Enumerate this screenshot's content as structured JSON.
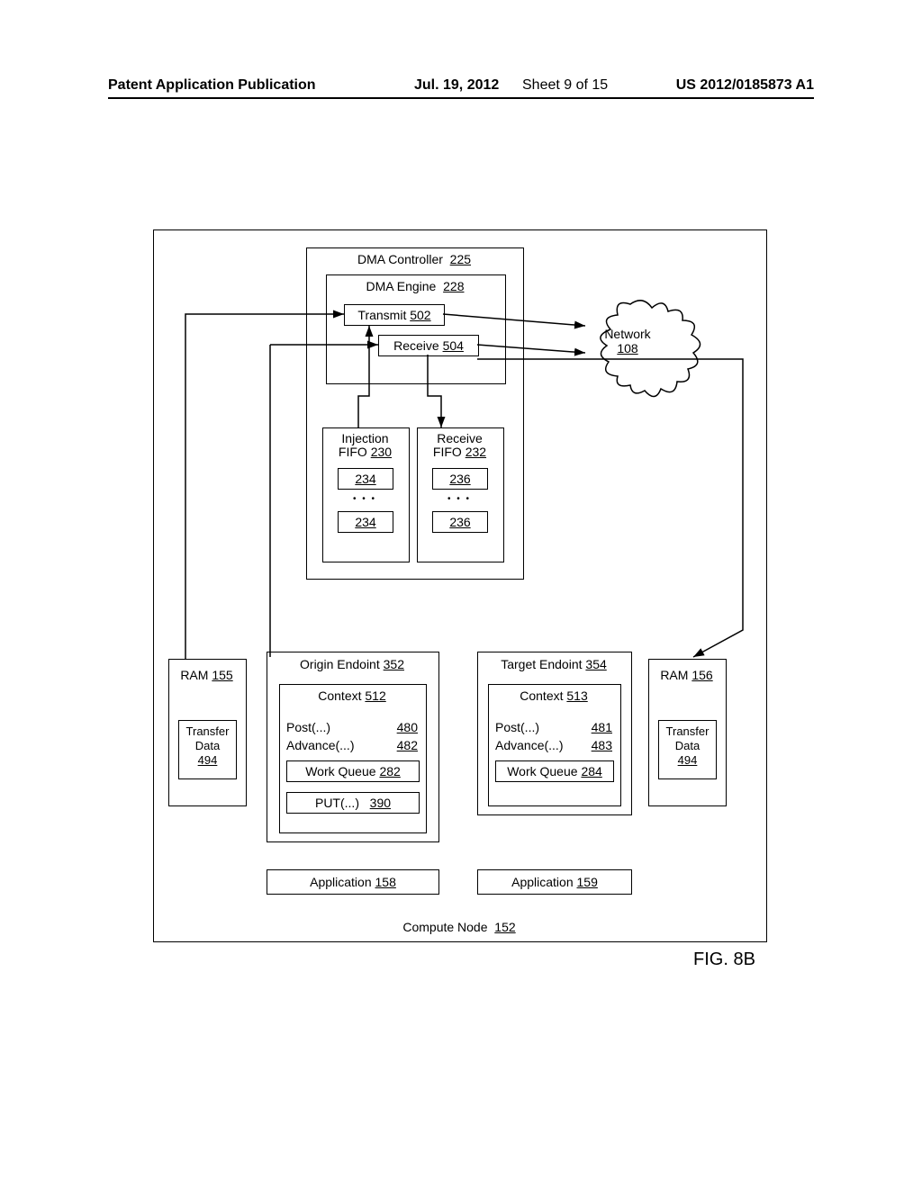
{
  "header": {
    "left": "Patent Application Publication",
    "date": "Jul. 19, 2012",
    "sheet": "Sheet 9 of 15",
    "pubno": "US 2012/0185873 A1"
  },
  "dma_controller": {
    "label": "DMA Controller",
    "ref": "225"
  },
  "dma_engine": {
    "label": "DMA Engine",
    "ref": "228"
  },
  "transmit": {
    "label": "Transmit",
    "ref": "502"
  },
  "receive": {
    "label": "Receive",
    "ref": "504"
  },
  "network": {
    "label": "Network",
    "ref": "108"
  },
  "injection_fifo": {
    "label1": "Injection",
    "label2": "FIFO",
    "ref": "230"
  },
  "receive_fifo": {
    "label1": "Receive",
    "label2": "FIFO",
    "ref": "232"
  },
  "inj_item": {
    "ref": "234"
  },
  "rec_item": {
    "ref": "236"
  },
  "ram_left": {
    "label": "RAM",
    "ref": "155"
  },
  "ram_right": {
    "label": "RAM",
    "ref": "156"
  },
  "transfer_data": {
    "label1": "Transfer",
    "label2": "Data",
    "ref": "494"
  },
  "origin_ep": {
    "label": "Origin Endoint",
    "ref": "352"
  },
  "target_ep": {
    "label": "Target Endoint",
    "ref": "354"
  },
  "context_left": {
    "label": "Context",
    "ref": "512"
  },
  "context_right": {
    "label": "Context",
    "ref": "513"
  },
  "post_left": {
    "label": "Post(...)",
    "ref": "480"
  },
  "post_right": {
    "label": "Post(...)",
    "ref": "481"
  },
  "advance_left": {
    "label": "Advance(...)",
    "ref": "482"
  },
  "advance_right": {
    "label": "Advance(...)",
    "ref": "483"
  },
  "work_queue_left": {
    "label": "Work Queue",
    "ref": "282"
  },
  "work_queue_right": {
    "label": "Work Queue",
    "ref": "284"
  },
  "put": {
    "label": "PUT(...)",
    "ref": "390"
  },
  "app_left": {
    "label": "Application",
    "ref": "158"
  },
  "app_right": {
    "label": "Application",
    "ref": "159"
  },
  "compute_node": {
    "label": "Compute Node",
    "ref": "152"
  },
  "figure": "FIG. 8B"
}
